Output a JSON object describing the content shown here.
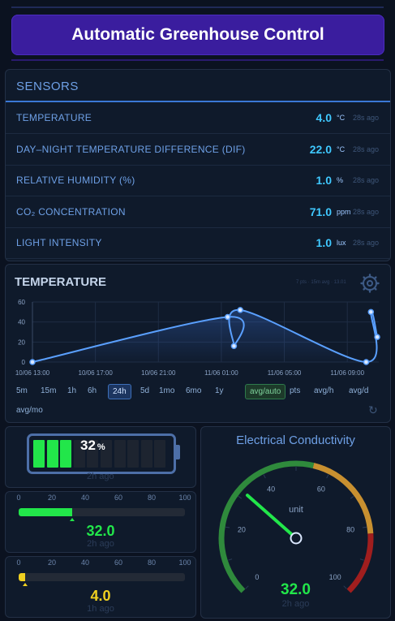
{
  "app": {
    "title": "Automatic Greenhouse Control"
  },
  "sensors": {
    "title": "SENSORS",
    "rows": [
      {
        "label": "TEMPERATURE",
        "value": "4.0",
        "unit": "°C",
        "ago": "28s ago"
      },
      {
        "label": "DAY–NIGHT TEMPERATURE DIFFERENCE (DIF)",
        "value": "22.0",
        "unit": "°C",
        "ago": "28s ago"
      },
      {
        "label": "RELATIVE HUMIDITY (%)",
        "value": "1.0",
        "unit": "%",
        "ago": "28s ago"
      },
      {
        "label": "CO₂ CONCENTRATION",
        "value": "71.0",
        "unit": "ppm",
        "ago": "28s ago"
      },
      {
        "label": "LIGHT INTENSITY",
        "value": "1.0",
        "unit": "lux",
        "ago": "28s ago"
      }
    ]
  },
  "temperature_chart": {
    "title": "TEMPERATURE",
    "meta": "7 pts · 15m avg · 13.01",
    "settings_icon": "gear-icon",
    "ranges": [
      "5m",
      "15m",
      "1h",
      "6h",
      "24h",
      "5d",
      "1mo",
      "6mo",
      "1y",
      "avg/auto",
      "pts",
      "avg/h",
      "avg/d",
      "avg/mo"
    ],
    "active_range": "24h",
    "active_mode": "avg/auto",
    "refresh_icon": "refresh-icon"
  },
  "chart_data": {
    "type": "line",
    "x": [
      "10/06 13:00",
      "11/06 01:25",
      "11/06 01:50",
      "11/06 02:15",
      "11/06 10:10",
      "11/06 10:30",
      "11/06 10:55"
    ],
    "x_hours": [
      0,
      12.4,
      12.8,
      13.2,
      21.2,
      21.5,
      21.9
    ],
    "values": [
      0,
      45,
      16,
      52,
      0,
      50,
      25
    ],
    "xticks": [
      "10/06 13:00",
      "10/06 17:00",
      "10/06 21:00",
      "11/06 01:00",
      "11/06 05:00",
      "11/06 09:00"
    ],
    "yticks": [
      0,
      20,
      40,
      60
    ],
    "ylim": [
      0,
      60
    ],
    "xlim_hours": [
      0,
      22
    ],
    "title": "TEMPERATURE",
    "grid": true,
    "color": "#5aa0ff"
  },
  "battery": {
    "percent": 32,
    "value_label": "32",
    "unit": "%",
    "ago": "2h ago",
    "segments": 10,
    "color": "#22e64a"
  },
  "bars": [
    {
      "ticks": [
        "0",
        "20",
        "40",
        "60",
        "80",
        "100"
      ],
      "value": 32.0,
      "value_label": "32.0",
      "ago": "2h ago",
      "color": "#22e64a",
      "text_color": "#22e64a"
    },
    {
      "ticks": [
        "0",
        "20",
        "40",
        "60",
        "80",
        "100"
      ],
      "value": 4.0,
      "value_label": "4.0",
      "ago": "1h ago",
      "color": "#f0d020",
      "text_color": "#f0d020"
    }
  ],
  "ec_gauge": {
    "title": "Electrical Conductivity",
    "unit": "unit",
    "min": 0,
    "max": 100,
    "ticks": [
      "0",
      "20",
      "40",
      "60",
      "80",
      "100"
    ],
    "value": 32.0,
    "value_label": "32.0",
    "ago": "2h ago",
    "colors": {
      "low": "#2f8a3c",
      "mid": "#c89030",
      "high": "#a01e1e",
      "needle": "#22e64a"
    }
  }
}
